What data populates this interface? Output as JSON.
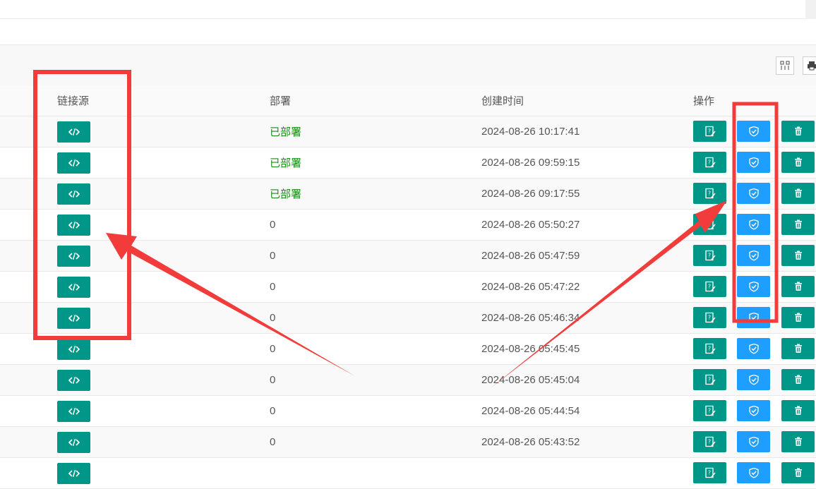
{
  "table": {
    "headers": {
      "link_source": "链接源",
      "deploy": "部署",
      "created_time": "创建时间",
      "actions": "操作"
    },
    "rows": [
      {
        "deploy": "已部署",
        "deployed": true,
        "created": "2024-08-26 10:17:41"
      },
      {
        "deploy": "已部署",
        "deployed": true,
        "created": "2024-08-26 09:59:15"
      },
      {
        "deploy": "已部署",
        "deployed": true,
        "created": "2024-08-26 09:17:55"
      },
      {
        "deploy": "0",
        "deployed": false,
        "created": "2024-08-26 05:50:27"
      },
      {
        "deploy": "0",
        "deployed": false,
        "created": "2024-08-26 05:47:59"
      },
      {
        "deploy": "0",
        "deployed": false,
        "created": "2024-08-26 05:47:22"
      },
      {
        "deploy": "0",
        "deployed": false,
        "created": "2024-08-26 05:46:34"
      },
      {
        "deploy": "0",
        "deployed": false,
        "created": "2024-08-26 05:45:45"
      },
      {
        "deploy": "0",
        "deployed": false,
        "created": "2024-08-26 05:45:04"
      },
      {
        "deploy": "0",
        "deployed": false,
        "created": "2024-08-26 05:44:54"
      },
      {
        "deploy": "0",
        "deployed": false,
        "created": "2024-08-26 05:43:52"
      },
      {
        "deploy": "",
        "deployed": false,
        "created": ""
      }
    ]
  },
  "icons": {
    "toolbar": [
      "columns-icon",
      "print-icon"
    ],
    "row_actions": [
      "code-icon",
      "edit-icon",
      "shield-check-icon",
      "trash-icon"
    ]
  },
  "colors": {
    "green": "#009688",
    "blue": "#1E9FFF",
    "deployed_text": "#1a8a1a",
    "annotation_red": "#f23b3b"
  }
}
